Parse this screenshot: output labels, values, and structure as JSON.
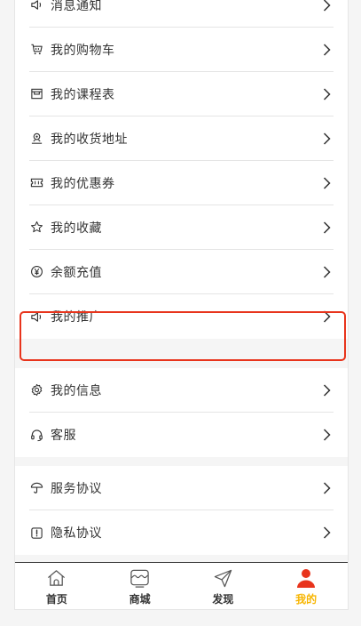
{
  "menu_group_1": [
    {
      "label": "消息通知",
      "icon": "speaker-icon"
    },
    {
      "label": "我的购物车",
      "icon": "cart-icon"
    },
    {
      "label": "我的课程表",
      "icon": "calendar-icon"
    },
    {
      "label": "我的收货地址",
      "icon": "location-icon"
    },
    {
      "label": "我的优惠券",
      "icon": "coupon-icon"
    },
    {
      "label": "我的收藏",
      "icon": "star-icon"
    },
    {
      "label": "余额充值",
      "icon": "yen-icon"
    },
    {
      "label": "我的推广",
      "icon": "speaker-icon"
    }
  ],
  "menu_group_2": [
    {
      "label": "我的信息",
      "icon": "gear-icon"
    },
    {
      "label": "客服",
      "icon": "headset-icon"
    }
  ],
  "menu_group_3": [
    {
      "label": "服务协议",
      "icon": "umbrella-icon"
    },
    {
      "label": "隐私协议",
      "icon": "shield-icon"
    }
  ],
  "tabbar": [
    {
      "label": "首页",
      "icon": "home-icon"
    },
    {
      "label": "商城",
      "icon": "shop-icon"
    },
    {
      "label": "发现",
      "icon": "send-icon"
    },
    {
      "label": "我的",
      "icon": "user-icon",
      "active": true
    }
  ],
  "colors": {
    "accent": "#f7b500",
    "active_user": "#e8341c",
    "highlight": "#e8341c"
  }
}
